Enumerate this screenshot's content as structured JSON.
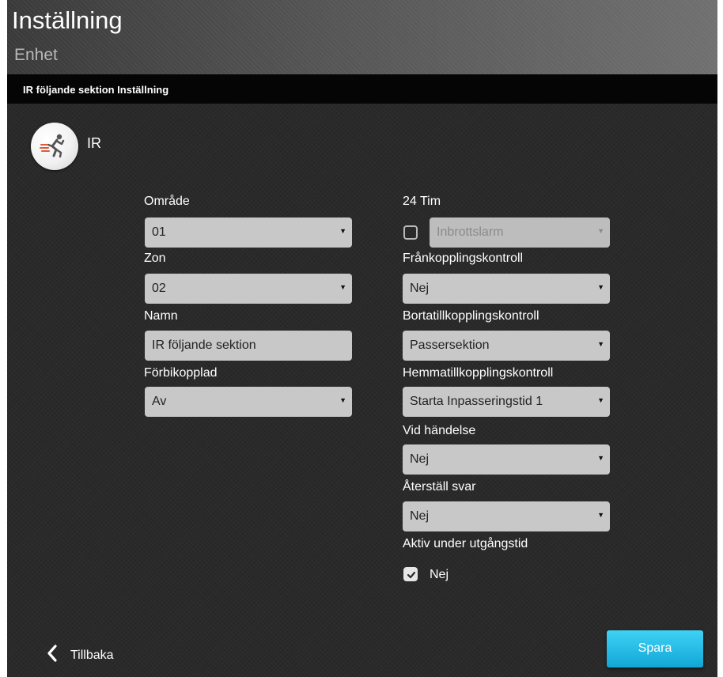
{
  "header": {
    "title": "Inställning",
    "subtitle": "Enhet"
  },
  "section": {
    "title": "IR följande sektion Inställning"
  },
  "device": {
    "icon": "running-person-icon",
    "label": "IR"
  },
  "left": {
    "area_label": "Område",
    "area_value": "01",
    "zone_label": "Zon",
    "zone_value": "02",
    "name_label": "Namn",
    "name_value": "IR följande sektion",
    "bypass_label": "Förbikopplad",
    "bypass_value": "Av"
  },
  "right": {
    "hour24_label": "24 Tim",
    "hour24_checked": false,
    "hour24_value": "Inbrottslarm",
    "disarm_label": "Frånkopplingskontroll",
    "disarm_value": "Nej",
    "away_label": "Bortatillkopplingskontroll",
    "away_value": "Passersektion",
    "home_label": "Hemmatillkopplingskontroll",
    "home_value": "Starta Inpasseringstid 1",
    "event_label": "Vid händelse",
    "event_value": "Nej",
    "restore_label": "Återställ svar",
    "restore_value": "Nej",
    "exit_label": "Aktiv under utgångstid",
    "exit_checked": true,
    "exit_value": "Nej"
  },
  "footer": {
    "back_label": "Tillbaka",
    "save_label": "Spara"
  },
  "colors": {
    "accent": "#1fb8e6",
    "field_bg": "#c8c8c8",
    "section_bar": "#050505"
  }
}
